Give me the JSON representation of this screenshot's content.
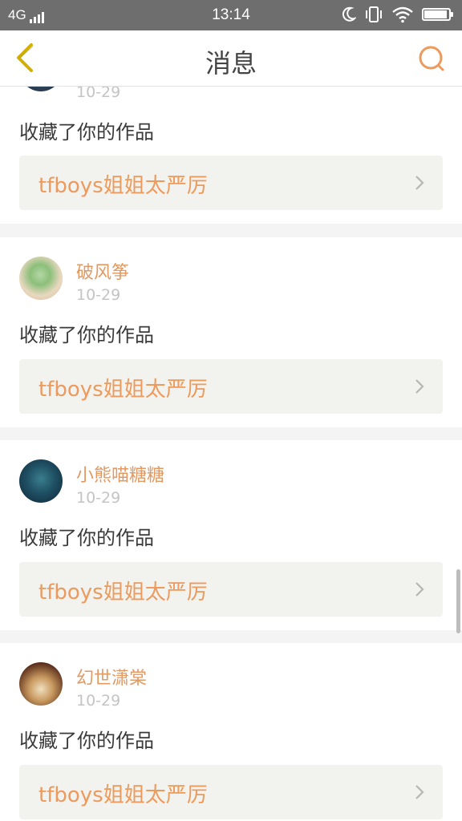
{
  "status_bar": {
    "network": "4G",
    "time": "13:14",
    "battery_level": 0.95
  },
  "header": {
    "title": "消息",
    "back_icon": "chevron-left-icon",
    "search_icon": "search-icon"
  },
  "notifications": [
    {
      "user": "",
      "date": "10-29",
      "action": "收藏了你的作品",
      "work_title": "tfboys姐姐太严厉"
    },
    {
      "user": "破风筝",
      "date": "10-29",
      "action": "收藏了你的作品",
      "work_title": "tfboys姐姐太严厉"
    },
    {
      "user": "小熊喵糖糖",
      "date": "10-29",
      "action": "收藏了你的作品",
      "work_title": "tfboys姐姐太严厉"
    },
    {
      "user": "幻世潇棠",
      "date": "10-29",
      "action": "收藏了你的作品",
      "work_title": "tfboys姐姐太严厉"
    }
  ],
  "colors": {
    "accent": "#ec9a5d",
    "username": "#e29a62",
    "back_icon": "#d3b000",
    "status_bar_bg": "#6e6e6e"
  }
}
